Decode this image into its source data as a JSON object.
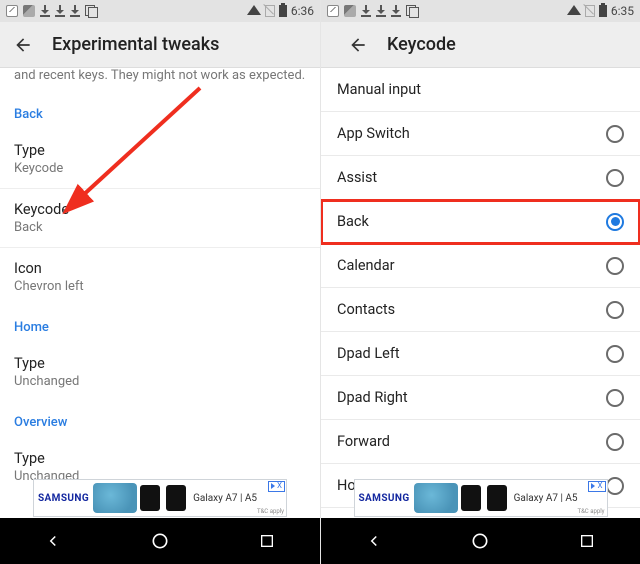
{
  "left": {
    "status": {
      "time": "6:36"
    },
    "appbar": {
      "title": "Experimental tweaks"
    },
    "truncated_line": "and recent keys. They might not work as expected.",
    "sections": {
      "back": {
        "header": "Back",
        "type": {
          "label": "Type",
          "value": "Keycode"
        },
        "keycode": {
          "label": "Keycode",
          "value": "Back"
        },
        "icon": {
          "label": "Icon",
          "value": "Chevron left"
        }
      },
      "home": {
        "header": "Home",
        "type": {
          "label": "Type",
          "value": "Unchanged"
        }
      },
      "overview": {
        "header": "Overview",
        "type": {
          "label": "Type",
          "value": "Unchanged"
        }
      }
    },
    "ad": {
      "brand": "SAMSUNG",
      "product": "Galaxy A7 | A5",
      "badge": "X",
      "terms": "T&C apply"
    }
  },
  "right": {
    "status": {
      "time": "6:35"
    },
    "appbar": {
      "title": "Keycode"
    },
    "options": [
      {
        "label": "Manual input",
        "selected": false,
        "radio": false
      },
      {
        "label": "App Switch",
        "selected": false,
        "radio": true
      },
      {
        "label": "Assist",
        "selected": false,
        "radio": true
      },
      {
        "label": "Back",
        "selected": true,
        "radio": true
      },
      {
        "label": "Calendar",
        "selected": false,
        "radio": true
      },
      {
        "label": "Contacts",
        "selected": false,
        "radio": true
      },
      {
        "label": "Dpad Left",
        "selected": false,
        "radio": true
      },
      {
        "label": "Dpad Right",
        "selected": false,
        "radio": true
      },
      {
        "label": "Forward",
        "selected": false,
        "radio": true
      },
      {
        "label": "Home",
        "selected": false,
        "radio": true
      }
    ],
    "ad": {
      "brand": "SAMSUNG",
      "product": "Galaxy A7 | A5",
      "badge": "X",
      "terms": "T&C apply"
    }
  },
  "annotation": {
    "arrow_color": "#ef2e1f",
    "highlight_color": "#ef2e1f"
  }
}
